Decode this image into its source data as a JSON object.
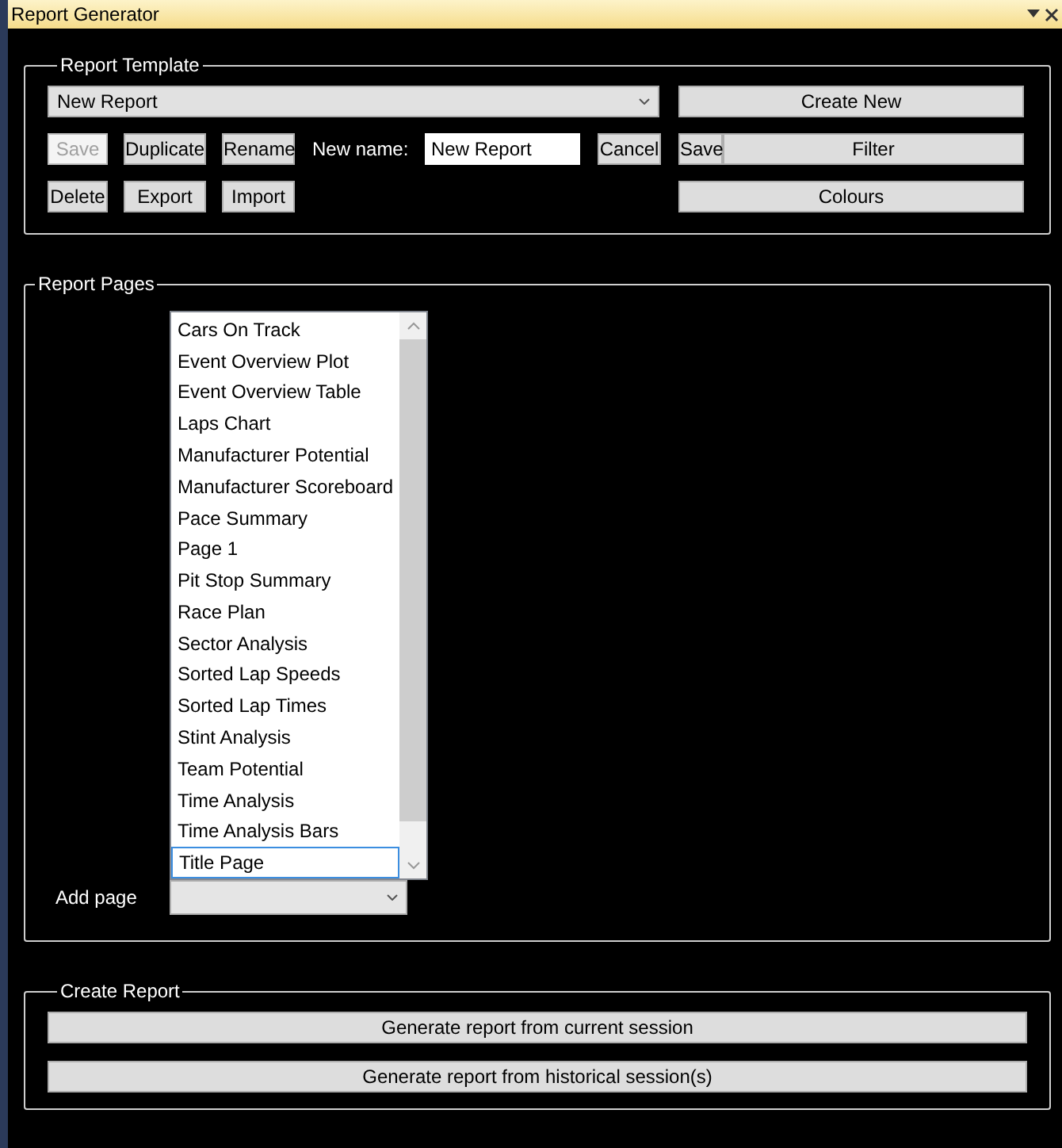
{
  "window": {
    "title": "Report Generator"
  },
  "report_template": {
    "legend": "Report Template",
    "template_dropdown": {
      "value": "New Report"
    },
    "create_new": "Create New",
    "row_buttons": [
      {
        "label": "Save",
        "disabled": true
      },
      {
        "label": "Duplicate",
        "disabled": false
      },
      {
        "label": "Rename",
        "disabled": false
      }
    ],
    "new_name": {
      "label": "New name:",
      "value": "New Report"
    },
    "cancel": "Cancel",
    "filter_save": "Save",
    "filter": "Filter",
    "row2_buttons": [
      {
        "label": "Delete",
        "disabled": false
      },
      {
        "label": "Export",
        "disabled": false
      },
      {
        "label": "Import",
        "disabled": false
      }
    ],
    "colours": "Colours"
  },
  "report_pages": {
    "legend": "Report Pages",
    "pages": [
      {
        "label": "Cars On Track",
        "selected": false
      },
      {
        "label": "Event Overview Plot",
        "selected": false
      },
      {
        "label": "Event Overview Table",
        "selected": false
      },
      {
        "label": "Laps Chart",
        "selected": false
      },
      {
        "label": "Manufacturer Potential",
        "selected": false
      },
      {
        "label": "Manufacturer Scoreboard",
        "selected": false
      },
      {
        "label": "Pace Summary",
        "selected": false
      },
      {
        "label": "Page 1",
        "selected": false
      },
      {
        "label": "Pit Stop Summary",
        "selected": false
      },
      {
        "label": "Race Plan",
        "selected": false
      },
      {
        "label": "Sector Analysis",
        "selected": false
      },
      {
        "label": "Sorted Lap Speeds",
        "selected": false
      },
      {
        "label": "Sorted Lap Times",
        "selected": false
      },
      {
        "label": "Stint Analysis",
        "selected": false
      },
      {
        "label": "Team Potential",
        "selected": false
      },
      {
        "label": "Time Analysis",
        "selected": false
      },
      {
        "label": "Time Analysis Bars",
        "selected": false
      },
      {
        "label": "Title Page",
        "selected": true
      }
    ],
    "add_page_label": "Add page"
  },
  "create_report": {
    "legend": "Create Report",
    "buttons": [
      "Generate report from current session",
      "Generate report from historical session(s)"
    ]
  }
}
